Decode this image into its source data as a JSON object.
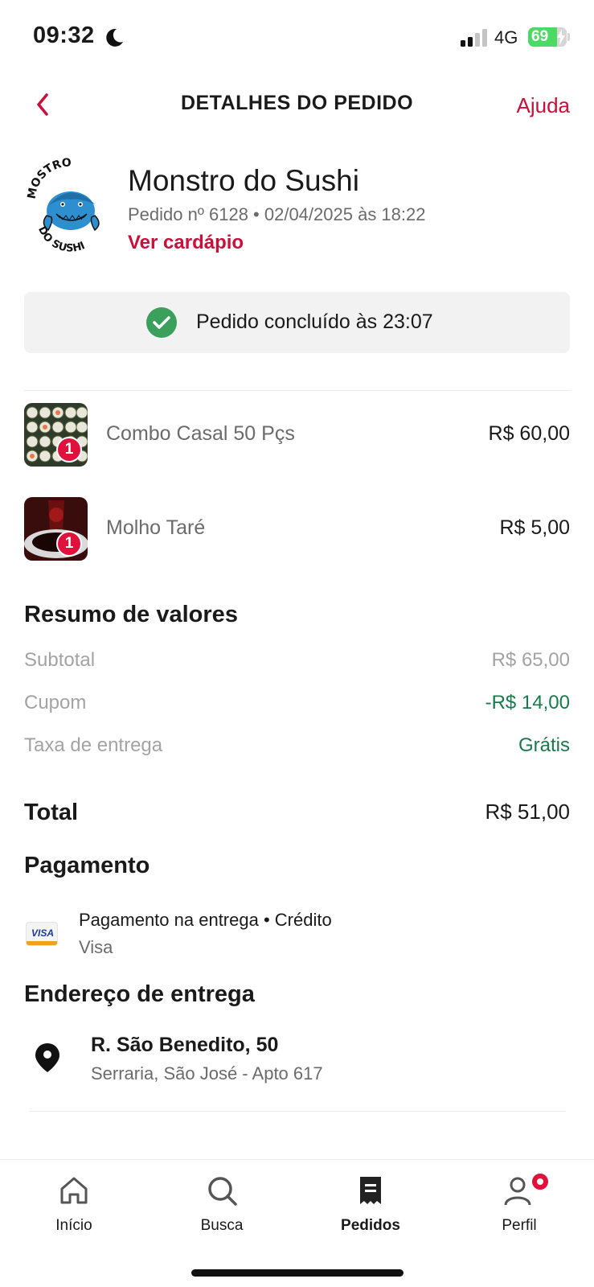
{
  "status_bar": {
    "time": "09:32",
    "network": "4G",
    "battery": "69",
    "battery_level": 0.69
  },
  "header": {
    "title": "DETALHES DO PEDIDO",
    "help": "Ajuda"
  },
  "restaurant": {
    "name": "Monstro do Sushi",
    "meta": "Pedido nº 6128 • 02/04/2025 às 18:22",
    "menu_link": "Ver cardápio",
    "logo_text_top": "MOSTRO",
    "logo_text_bottom": "DO SUSHI"
  },
  "order_status": {
    "text": "Pedido concluído às 23:07"
  },
  "items": [
    {
      "quantity": "1",
      "name": "Combo Casal 50 Pçs",
      "price": "R$ 60,00"
    },
    {
      "quantity": "1",
      "name": "Molho Taré",
      "price": "R$ 5,00"
    }
  ],
  "summary": {
    "title": "Resumo de valores",
    "subtotal_label": "Subtotal",
    "subtotal_value": "R$ 65,00",
    "coupon_label": "Cupom",
    "coupon_value": "-R$ 14,00",
    "delivery_label": "Taxa de entrega",
    "delivery_value": "Grátis",
    "total_label": "Total",
    "total_value": "R$ 51,00"
  },
  "payment": {
    "title": "Pagamento",
    "method": "Pagamento na entrega • Crédito",
    "brand": "Visa",
    "card_logo_text": "VISA"
  },
  "address": {
    "title": "Endereço de entrega",
    "street": "R. São Benedito, 50",
    "details": "Serraria, São José - Apto 617"
  },
  "nav": {
    "home": "Início",
    "search": "Busca",
    "orders": "Pedidos",
    "profile": "Perfil"
  },
  "colors": {
    "brand": "#c8103a",
    "success": "#1a7a4c",
    "check": "#3aa05c"
  }
}
